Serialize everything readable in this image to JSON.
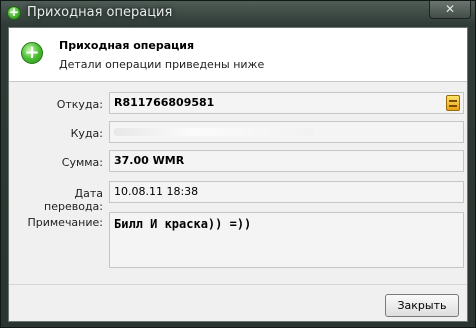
{
  "window": {
    "title": "Приходная операция",
    "close_glyph": "✕"
  },
  "header": {
    "title": "Приходная операция",
    "subtitle": "Детали операции приведены ниже",
    "icon": "plus-icon"
  },
  "fields": {
    "from": {
      "label": "Откуда:",
      "value": "R811766809581",
      "icon": "wallet-icon"
    },
    "to": {
      "label": "Куда:",
      "value": ""
    },
    "amount": {
      "label": "Сумма:",
      "value": "37.00 WMR"
    },
    "date": {
      "label": "Дата перевода:",
      "value": "10.08.11 18:38"
    },
    "note": {
      "label": "Примечание:",
      "value": "Билл И краска)) =))"
    }
  },
  "footer": {
    "close_label": "Закрыть"
  },
  "colors": {
    "titlebar": "#2f3b36",
    "panel": "#f0f0f0",
    "accent_green": "#44b22e"
  }
}
